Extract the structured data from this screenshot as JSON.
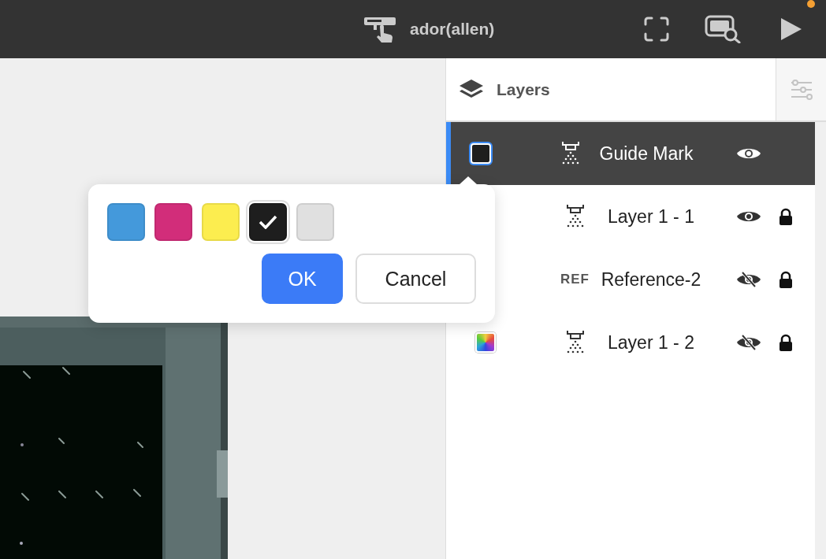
{
  "top_bar": {
    "device_name": "ador(allen)",
    "run_notification": true
  },
  "layers_panel": {
    "title": "Layers",
    "layers": [
      {
        "name": "Guide Mark",
        "kind": "printing",
        "color": "#1e1e1e",
        "full_color": false,
        "selected": true,
        "visible": true,
        "locked": false
      },
      {
        "name": "Layer 1 - 1",
        "kind": "printing",
        "selected": false,
        "visible": true,
        "locked": true
      },
      {
        "name": "Reference-2",
        "kind": "reference",
        "badge": "REF",
        "selected": false,
        "visible": false,
        "locked": true
      },
      {
        "name": "Layer 1 - 2",
        "kind": "printing",
        "full_color": true,
        "selected": false,
        "visible": false,
        "locked": true
      }
    ]
  },
  "color_popover": {
    "swatches": [
      {
        "color": "#4499db",
        "selected": false
      },
      {
        "color": "#d22d7a",
        "selected": false
      },
      {
        "color": "#fced4f",
        "selected": false
      },
      {
        "color": "#1e1e1e",
        "selected": true
      },
      {
        "color": "#e0e0e0",
        "selected": false
      }
    ],
    "ok_button": "OK",
    "cancel_button": "Cancel"
  }
}
